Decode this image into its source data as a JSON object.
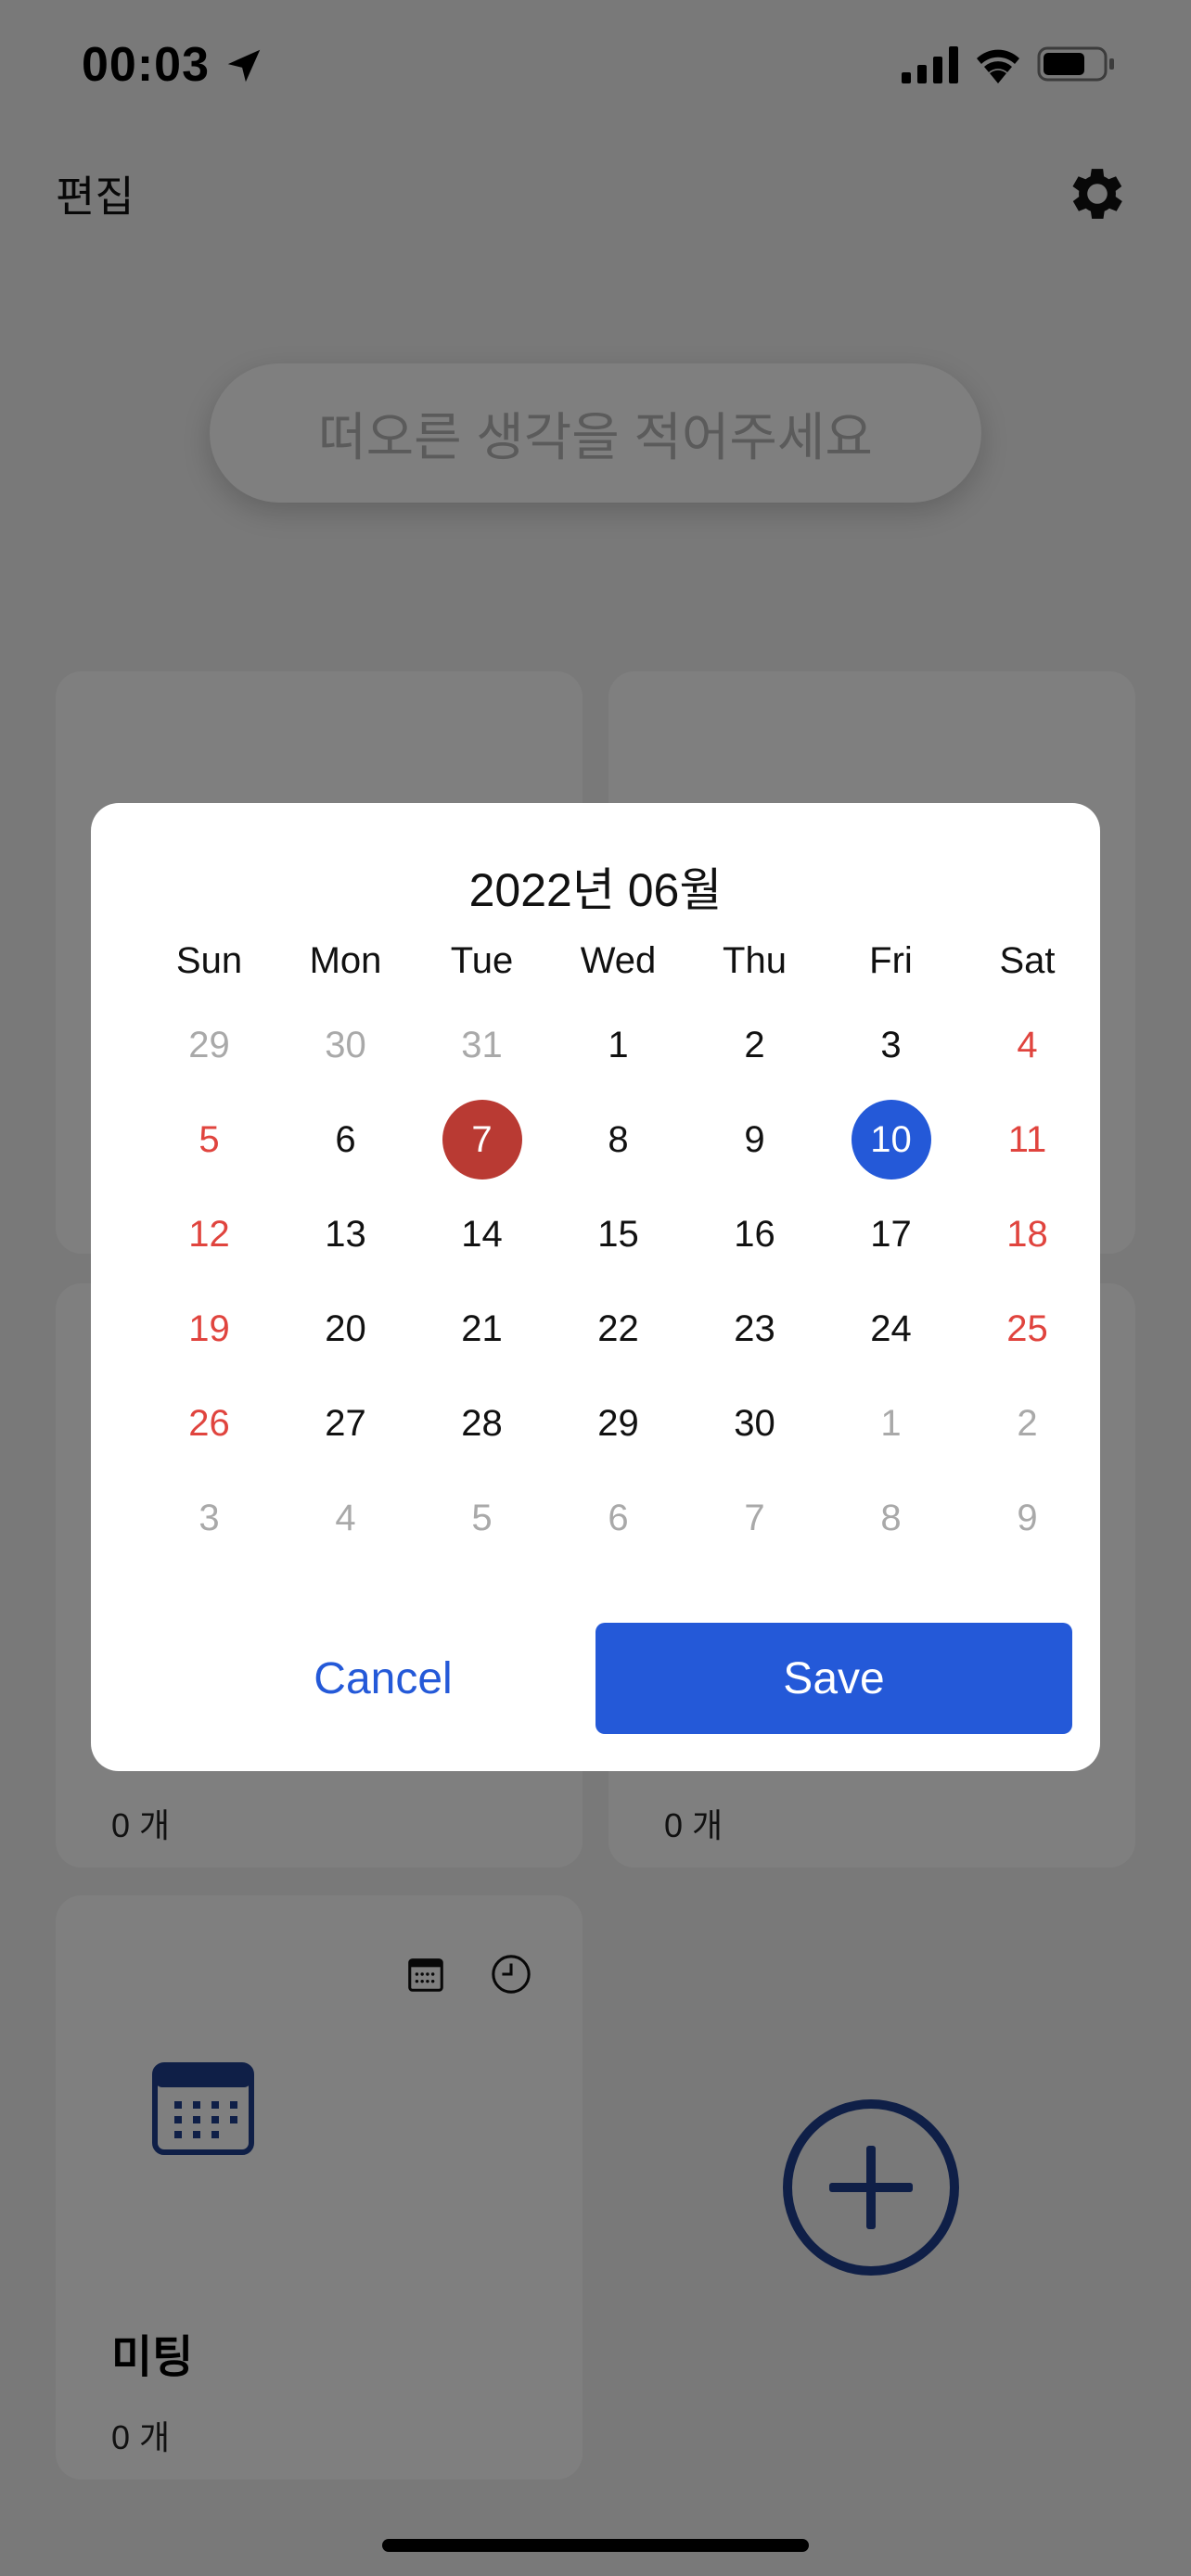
{
  "status_bar": {
    "time": "00:03"
  },
  "header": {
    "edit_label": "편집"
  },
  "search": {
    "placeholder": "떠오른 생각을 적어주세요"
  },
  "cards": {
    "left_middle_count": "0 개",
    "right_middle_count": "0 개",
    "meeting": {
      "title": "미팅",
      "count": "0 개"
    }
  },
  "colors": {
    "accent": "#2459d8",
    "today": "#b93a33",
    "weekend": "#e0443e",
    "muted": "#a9a9a9",
    "icon_navy": "#1f3f8f"
  },
  "calendar": {
    "title": "2022년 06월",
    "weekdays": [
      "Sun",
      "Mon",
      "Tue",
      "Wed",
      "Thu",
      "Fri",
      "Sat"
    ],
    "weeks": [
      [
        "29",
        "30",
        "31",
        "1",
        "2",
        "3",
        "4"
      ],
      [
        "5",
        "6",
        "7",
        "8",
        "9",
        "10",
        "11"
      ],
      [
        "12",
        "13",
        "14",
        "15",
        "16",
        "17",
        "18"
      ],
      [
        "19",
        "20",
        "21",
        "22",
        "23",
        "24",
        "25"
      ],
      [
        "26",
        "27",
        "28",
        "29",
        "30",
        "1",
        "2"
      ],
      [
        "3",
        "4",
        "5",
        "6",
        "7",
        "8",
        "9"
      ]
    ],
    "today": "7",
    "selected": "10"
  },
  "buttons": {
    "cancel": "Cancel",
    "save": "Save"
  },
  "icons": {
    "location": "location-arrow-icon",
    "signal": "cellular-signal-icon",
    "wifi": "wifi-icon",
    "battery": "battery-icon",
    "settings": "gear-icon",
    "calendar_small": "calendar-icon",
    "clock": "clock-icon",
    "calendar_large": "calendar-icon",
    "add": "plus-circle-icon"
  }
}
